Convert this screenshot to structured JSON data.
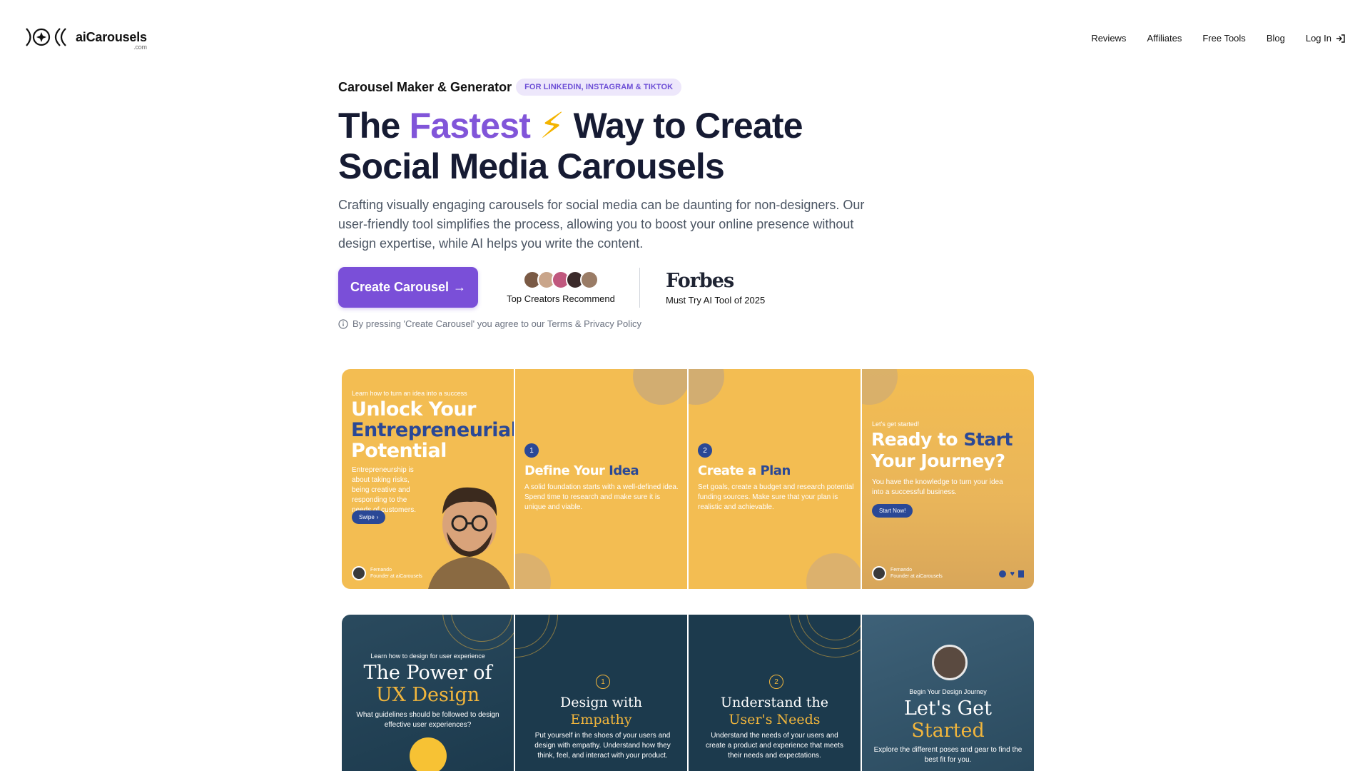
{
  "brand": {
    "name": "aiCarousels",
    "suffix": ".com"
  },
  "nav": {
    "items": [
      "Reviews",
      "Affiliates",
      "Free Tools",
      "Blog"
    ],
    "login": "Log In"
  },
  "hero": {
    "eyebrow": "Carousel Maker & Generator",
    "badge": "FOR LINKEDIN, INSTAGRAM & TIKTOK",
    "headline_pre": "The ",
    "headline_accent": "Fastest",
    "headline_bolt": "⚡",
    "headline_post": " Way to Create",
    "headline_line2": "Social Media Carousels",
    "description": "Crafting visually engaging carousels for social media can be daunting for non-designers. Our user-friendly tool simplifies the process, allowing you to boost your online presence without design expertise, while AI helps you write the content."
  },
  "cta": {
    "button": "Create Carousel",
    "arrow": "→",
    "creators": "Top Creators Recommend",
    "forbes_logo": "Forbes",
    "forbes_text": "Must Try AI Tool of 2025",
    "terms": "By pressing 'Create Carousel' you agree to our Terms & Privacy Policy"
  },
  "colors": {
    "accent": "#8155d9",
    "button": "#7a4fd8",
    "yellow": "#f3bd52",
    "navy": "#1c3a4d",
    "gold": "#f2b63c",
    "blue": "#2a4896"
  },
  "yellow_carousel": {
    "s1": {
      "kicker": "Learn how to turn an idea into a success",
      "t1": "Unlock Your",
      "t2": "Entrepreneurial",
      "t3": "Potential",
      "body": "Entrepreneurship is about taking risks, being creative and responding to the needs of customers.",
      "pill": "Swipe",
      "author": "Fernando",
      "role": "Founder at aiCarousels"
    },
    "s2": {
      "num": "1",
      "t1": "Define Your ",
      "t2": "Idea",
      "body": "A solid foundation starts with a well-defined idea. Spend time to research and make sure it is unique and viable."
    },
    "s3": {
      "num": "2",
      "t1": "Create a ",
      "t2": "Plan",
      "body": "Set goals, create a budget and research potential funding sources. Make sure that your plan is realistic and achievable."
    },
    "s4": {
      "kicker": "Let's get started!",
      "t1": "Ready to ",
      "t2": "Start",
      "t3": "Your Journey?",
      "body": "You have the knowledge to turn your idea into a successful business.",
      "pill": "Start Now!",
      "author": "Fernando",
      "role": "Founder at aiCarousels"
    }
  },
  "blue_carousel": {
    "s1": {
      "kicker": "Learn how to design for user experience",
      "t1": "The Power of",
      "t2": "UX Design",
      "body": "What guidelines should be followed to design effective user experiences?"
    },
    "s2": {
      "num": "1",
      "t1": "Design with",
      "t2": "Empathy",
      "body": "Put yourself in the shoes of your users and design with empathy. Understand how they think, feel, and interact with your product."
    },
    "s3": {
      "num": "2",
      "t1": "Understand the",
      "t2": "User's Needs",
      "body": "Understand the needs of your users and create a product and experience that meets their needs and expectations."
    },
    "s4": {
      "kicker": "Begin Your Design Journey",
      "t1": "Let's Get",
      "t2": "Started",
      "body": "Explore the different poses and gear to find the best fit for you."
    }
  }
}
